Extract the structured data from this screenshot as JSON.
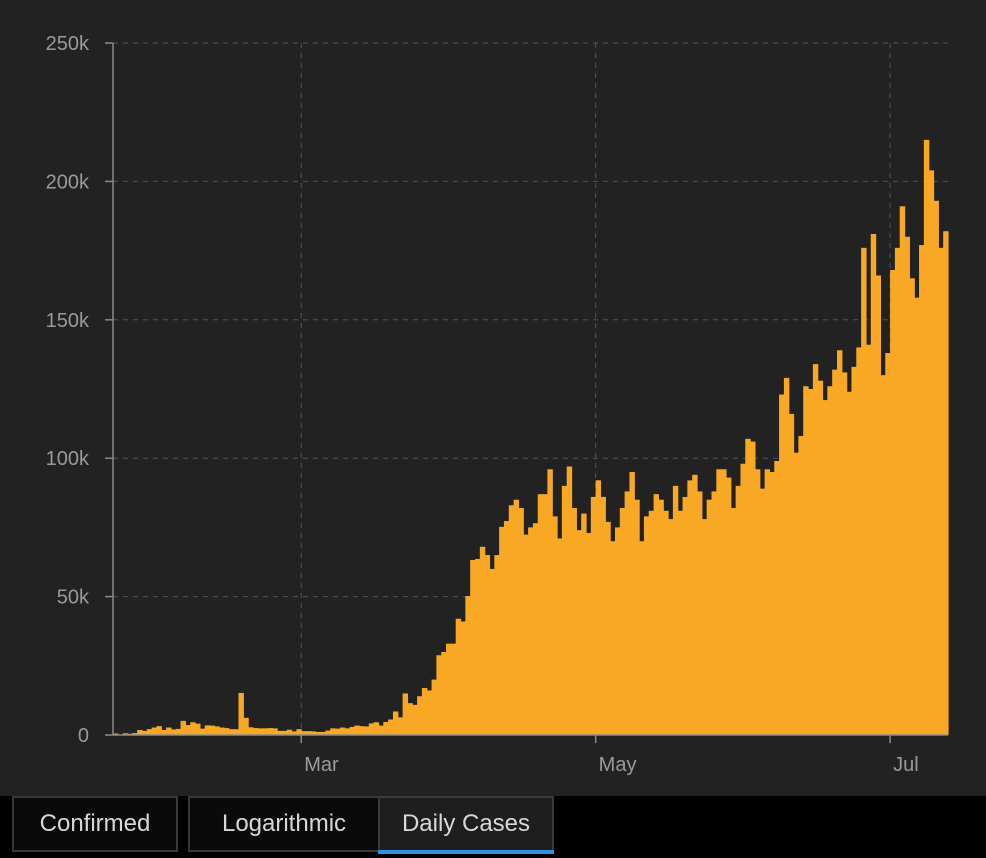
{
  "accent_color": "#f9a825",
  "tab_active_color": "#2f8fe0",
  "tabs": [
    {
      "label": "Confirmed",
      "active": false
    },
    {
      "label": "Logarithmic",
      "active": false
    },
    {
      "label": "Daily Cases",
      "active": true
    }
  ],
  "chart_data": {
    "type": "bar",
    "title": "",
    "xlabel": "",
    "ylabel": "",
    "ylim": [
      0,
      250000
    ],
    "yticks": [
      {
        "value": 0,
        "label": "0"
      },
      {
        "value": 50000,
        "label": "50k"
      },
      {
        "value": 100000,
        "label": "100k"
      },
      {
        "value": 150000,
        "label": "150k"
      },
      {
        "value": 200000,
        "label": "200k"
      },
      {
        "value": 250000,
        "label": "250k"
      }
    ],
    "xticks": [
      {
        "date": "2020-03-01",
        "label": "Mar"
      },
      {
        "date": "2020-05-01",
        "label": "May"
      },
      {
        "date": "2020-07-01",
        "label": "Jul"
      }
    ],
    "grid": true,
    "x_start": "2020-01-22",
    "x_end": "2020-07-02",
    "series": [
      {
        "color": "#f9a825",
        "values": [
          540,
          100,
          600,
          450,
          700,
          1800,
          1500,
          2100,
          2700,
          3200,
          1800,
          2700,
          2000,
          2200,
          5100,
          3600,
          4600,
          4100,
          2300,
          3500,
          3400,
          3100,
          2700,
          2500,
          2100,
          2100,
          15200,
          6200,
          2800,
          2500,
          2400,
          2400,
          2500,
          2400,
          1500,
          1500,
          1900,
          1300,
          2100,
          1400,
          1400,
          1300,
          1100,
          1100,
          1600,
          2400,
          2300,
          2700,
          2400,
          2900,
          3400,
          3200,
          3100,
          4200,
          4600,
          3400,
          4700,
          5600,
          8500,
          6400,
          15000,
          11500,
          10900,
          14000,
          17000,
          16100,
          20000,
          28800,
          30000,
          33000,
          33000,
          42000,
          41000,
          50200,
          63200,
          63600,
          68000,
          65000,
          60000,
          65000,
          75200,
          77300,
          83000,
          85000,
          82000,
          72400,
          75000,
          76500,
          87000,
          87000,
          96000,
          79000,
          71000,
          90000,
          97000,
          82000,
          74000,
          80000,
          73000,
          86000,
          92000,
          86000,
          77000,
          70000,
          75000,
          82000,
          88000,
          95000,
          85000,
          70000,
          79000,
          81000,
          87000,
          85000,
          81000,
          78000,
          90000,
          81000,
          86000,
          92000,
          94000,
          88000,
          78000,
          85000,
          88000,
          96000,
          96000,
          93000,
          82000,
          90000,
          98000,
          107000,
          106000,
          96000,
          89000,
          96000,
          95000,
          99000,
          123000,
          129000,
          116000,
          102000,
          108000,
          126000,
          125000,
          134000,
          128000,
          121000,
          126000,
          132000,
          139000,
          131000,
          124000,
          133000,
          140000,
          176000,
          141000,
          181000,
          166000,
          130000,
          138000,
          168000,
          176000,
          191000,
          180000,
          165000,
          158000,
          177000,
          215000,
          204000,
          193000,
          176000,
          182000
        ]
      }
    ]
  }
}
